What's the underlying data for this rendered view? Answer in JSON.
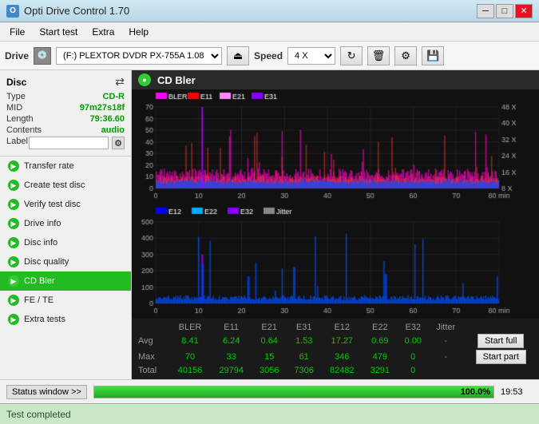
{
  "titlebar": {
    "title": "Opti Drive Control 1.70",
    "icon": "O"
  },
  "menubar": {
    "items": [
      "File",
      "Start test",
      "Extra",
      "Help"
    ]
  },
  "toolbar": {
    "drive_label": "Drive",
    "drive_value": "(F:)  PLEXTOR DVDR  PX-755A 1.08",
    "speed_label": "Speed",
    "speed_value": "4 X"
  },
  "disc": {
    "title": "Disc",
    "fields": {
      "type_label": "Type",
      "type_value": "CD-R",
      "mid_label": "MID",
      "mid_value": "97m27s18f",
      "length_label": "Length",
      "length_value": "79:36.60",
      "contents_label": "Contents",
      "contents_value": "audio",
      "label_label": "Label",
      "label_value": ""
    }
  },
  "sidebar": {
    "items": [
      {
        "id": "transfer-rate",
        "label": "Transfer rate",
        "active": false
      },
      {
        "id": "create-test-disc",
        "label": "Create test disc",
        "active": false
      },
      {
        "id": "verify-test-disc",
        "label": "Verify test disc",
        "active": false
      },
      {
        "id": "drive-info",
        "label": "Drive info",
        "active": false
      },
      {
        "id": "disc-info",
        "label": "Disc info",
        "active": false
      },
      {
        "id": "disc-quality",
        "label": "Disc quality",
        "active": false
      },
      {
        "id": "cd-bler",
        "label": "CD Bler",
        "active": true
      },
      {
        "id": "fe-te",
        "label": "FE / TE",
        "active": false
      },
      {
        "id": "extra-tests",
        "label": "Extra tests",
        "active": false
      }
    ]
  },
  "chart": {
    "title": "CD Bler",
    "top": {
      "legend": [
        {
          "label": "BLER",
          "color": "#ff00ff"
        },
        {
          "label": "E11",
          "color": "#ff0000"
        },
        {
          "label": "E21",
          "color": "#ff88ff"
        },
        {
          "label": "E31",
          "color": "#8800ff"
        }
      ],
      "y_max": 70,
      "y_labels": [
        "70",
        "60",
        "50",
        "40",
        "30",
        "20",
        "10",
        "0"
      ],
      "x_labels": [
        "0",
        "10",
        "20",
        "30",
        "40",
        "50",
        "60",
        "70",
        "80 min"
      ],
      "y2_labels": [
        "48 X",
        "40 X",
        "32 X",
        "24 X",
        "16 X",
        "8 X"
      ]
    },
    "bottom": {
      "legend": [
        {
          "label": "E12",
          "color": "#0000ff"
        },
        {
          "label": "E22",
          "color": "#00aaff"
        },
        {
          "label": "E32",
          "color": "#8800ff"
        },
        {
          "label": "Jitter",
          "color": "#888888"
        }
      ],
      "y_max": 500,
      "y_labels": [
        "500",
        "400",
        "300",
        "200",
        "100",
        "0"
      ],
      "x_labels": [
        "0",
        "10",
        "20",
        "30",
        "40",
        "50",
        "60",
        "70",
        "80 min"
      ]
    }
  },
  "stats": {
    "columns": [
      "",
      "BLER",
      "E11",
      "E21",
      "E31",
      "E12",
      "E22",
      "E32",
      "Jitter",
      ""
    ],
    "rows": [
      {
        "label": "Avg",
        "values": [
          "8.41",
          "6.24",
          "0.64",
          "1.53",
          "17.27",
          "0.69",
          "0.00",
          "-"
        ],
        "btn": "Start full"
      },
      {
        "label": "Max",
        "values": [
          "70",
          "33",
          "15",
          "61",
          "346",
          "479",
          "0",
          "-"
        ],
        "btn": "Start part"
      },
      {
        "label": "Total",
        "values": [
          "40156",
          "29794",
          "3056",
          "7306",
          "82482",
          "3291",
          "0",
          ""
        ]
      }
    ]
  },
  "statusbar": {
    "status_window_label": "Status window >>",
    "test_completed_label": "Test completed",
    "progress_pct": "100.0%",
    "progress_value": 100,
    "time": "19:53"
  }
}
